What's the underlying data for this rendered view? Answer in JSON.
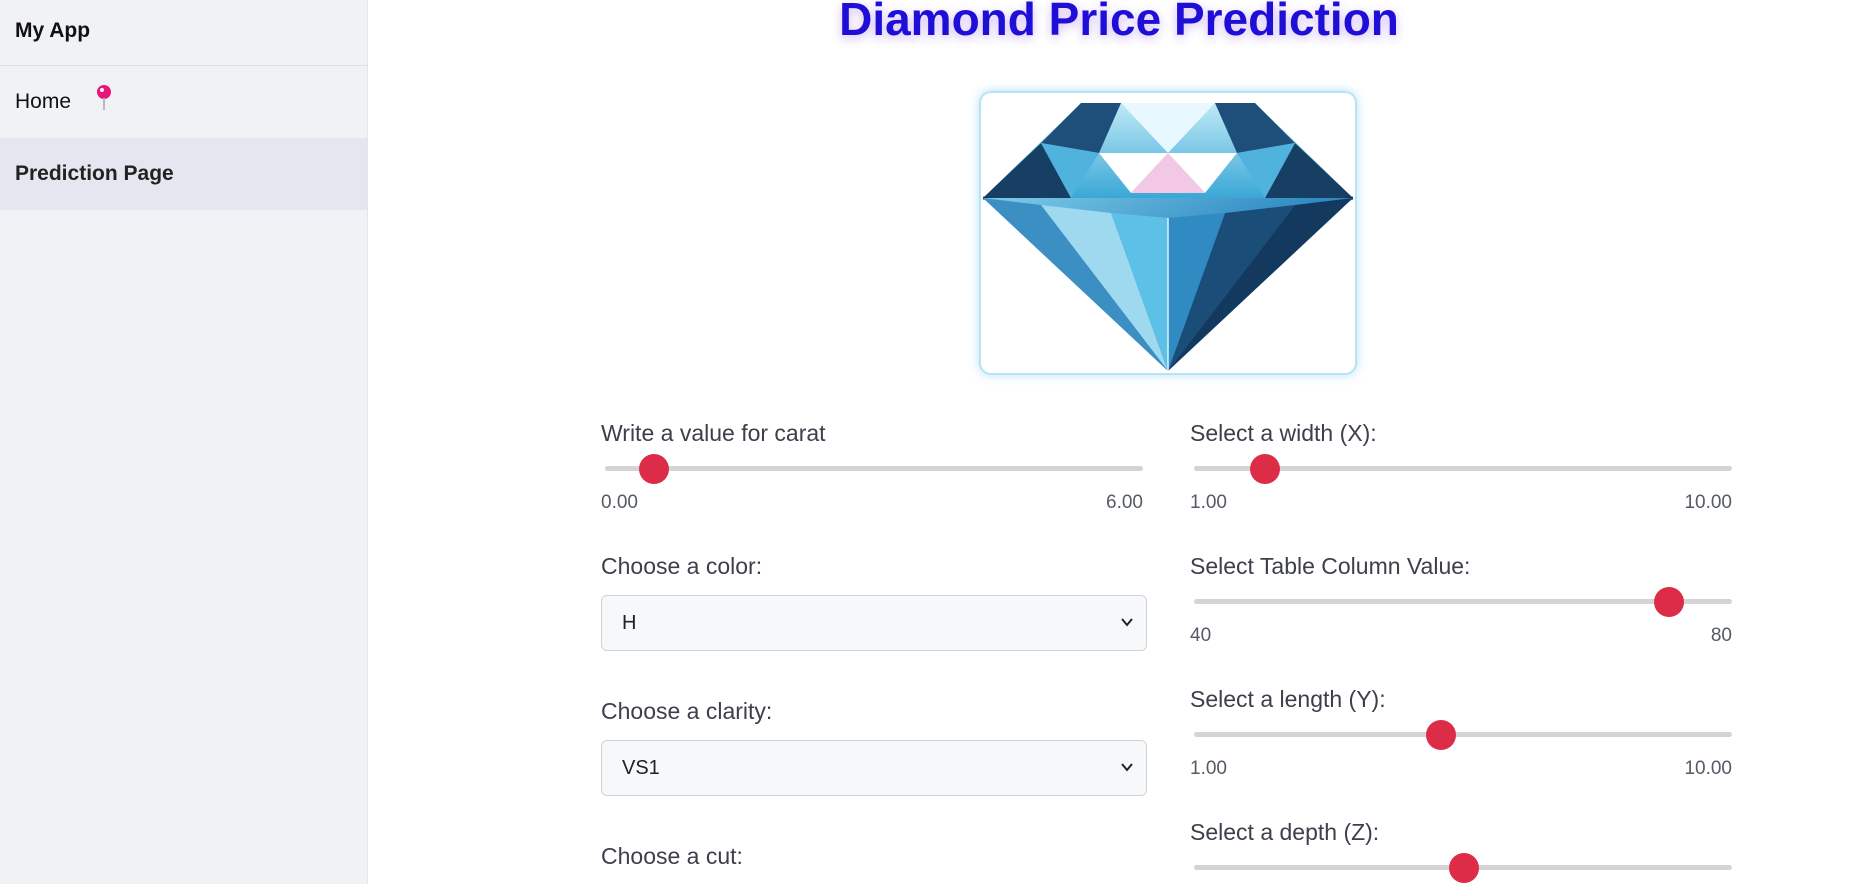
{
  "app": {
    "title": "My App"
  },
  "sidebar": {
    "items": [
      {
        "label": "Home"
      },
      {
        "label": "Prediction Page"
      }
    ]
  },
  "page": {
    "title": "Diamond Price Prediction",
    "hero_icon": "diamond-image"
  },
  "form": {
    "carat": {
      "label": "Write a value for carat",
      "min": "0.00",
      "max": "6.00",
      "value": 0.5
    },
    "color": {
      "label": "Choose a color:",
      "value": "H"
    },
    "clarity": {
      "label": "Choose a clarity:",
      "value": "VS1"
    },
    "cut": {
      "label": "Choose a cut:"
    },
    "width_x": {
      "label": "Select a width (X):",
      "min": "1.00",
      "max": "10.00",
      "value": 1.7
    },
    "table": {
      "label": "Select Table Column Value:",
      "min": "40",
      "max": "80",
      "value": 75
    },
    "length_y": {
      "label": "Select a length (Y):",
      "min": "1.00",
      "max": "10.00",
      "value": 5.18
    },
    "depth_z": {
      "label": "Select a depth (Z):",
      "value": 5.56
    }
  },
  "colors": {
    "accent": "#dd2c47",
    "title": "#1f0fd6",
    "sidebar_bg": "#f0f2f6"
  }
}
